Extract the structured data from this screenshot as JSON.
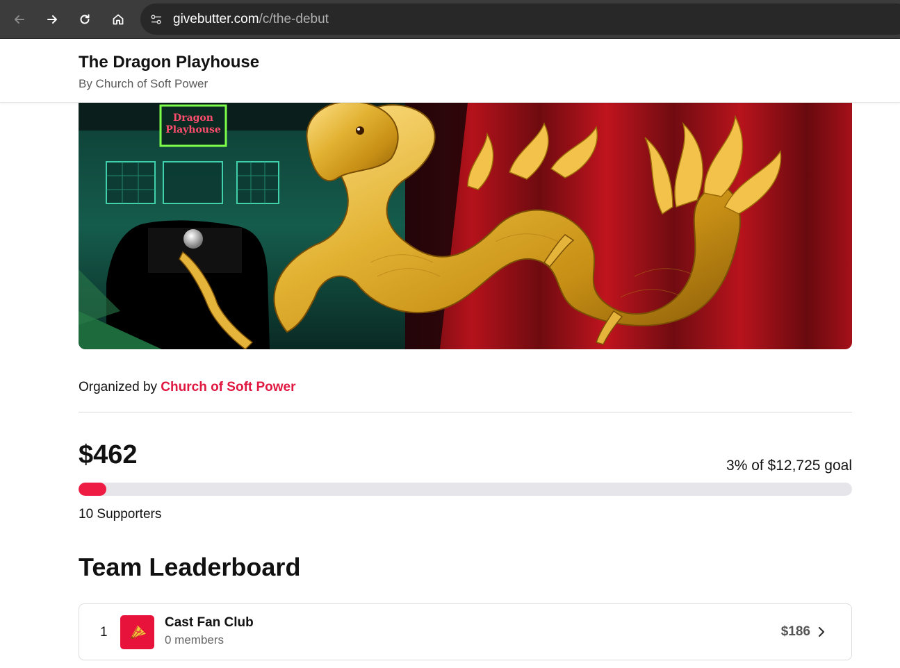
{
  "browser": {
    "url_domain": "givebutter.com",
    "url_path": "/c/the-debut"
  },
  "campaign": {
    "title": "The Dragon Playhouse",
    "byline": "By Church of Soft Power",
    "hero_sign_line1": "Dragon",
    "hero_sign_line2": "Playhouse"
  },
  "organizer": {
    "prefix": "Organized by",
    "name": "Church of Soft Power"
  },
  "fundraising": {
    "raised": "$462",
    "goal_text": "3% of $12,725 goal",
    "progress_percent": 3.6,
    "supporters": "10 Supporters"
  },
  "leaderboard": {
    "title": "Team Leaderboard",
    "teams": [
      {
        "rank": "1",
        "name": "Cast Fan Club",
        "members": "0 members",
        "amount": "$186",
        "avatar_icon": "fan-icon"
      }
    ]
  },
  "colors": {
    "accent": "#e0173f",
    "progress_fill": "#ee1b42",
    "progress_track": "#e5e5ea",
    "browser_chrome": "#3c3c3c"
  }
}
